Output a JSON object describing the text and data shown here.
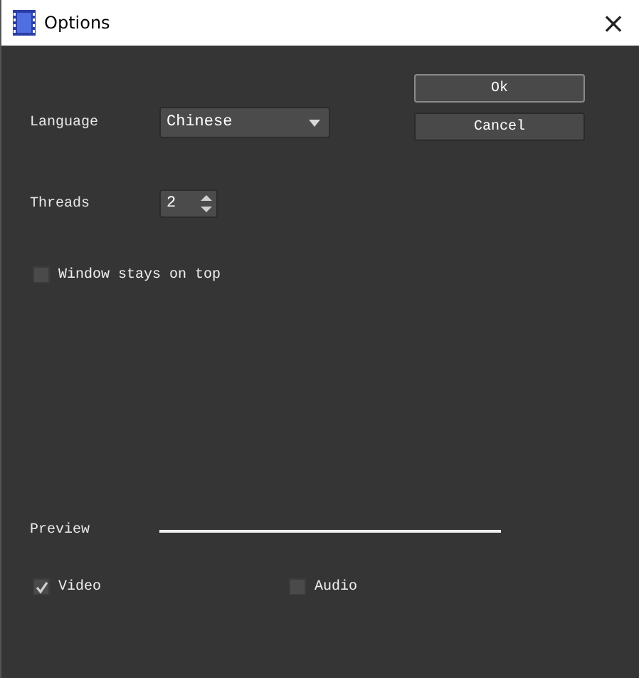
{
  "window": {
    "title": "Options",
    "close": "×"
  },
  "language": {
    "label": "Language",
    "value": "Chinese"
  },
  "buttons": [
    {
      "label": "Ok",
      "kind": "default"
    },
    {
      "label": "Cancel",
      "kind": "normal"
    }
  ],
  "threads": {
    "label": "Threads",
    "value": "2"
  },
  "stay_on_top": {
    "label": "Window stays on top",
    "checked": false
  },
  "preview": {
    "label": "Preview"
  },
  "streams": [
    {
      "label": "Video",
      "checked": true
    },
    {
      "label": "Audio",
      "checked": false
    }
  ]
}
